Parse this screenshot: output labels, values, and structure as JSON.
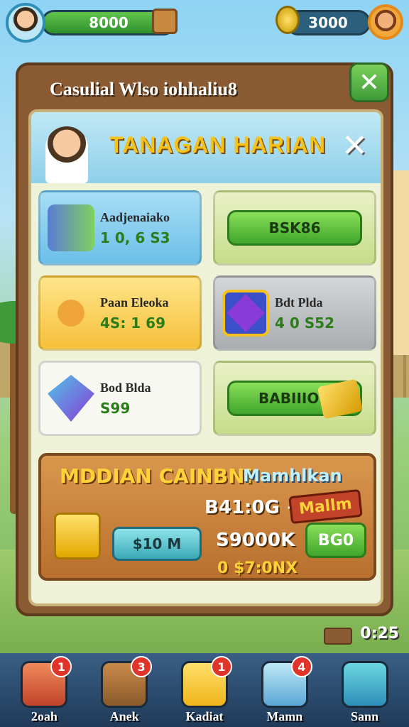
{
  "hud": {
    "coins": "8000",
    "gems": "3000"
  },
  "panel": {
    "title": "Casulial Wlso iohhaliu8",
    "close_label": "✕"
  },
  "banner": {
    "title": "TANAGAN HARIAN",
    "close_label": "✕"
  },
  "cards": [
    {
      "name": "Aadjenaiako",
      "value": "1 0, 6 S3"
    },
    {
      "button": "BSK86"
    },
    {
      "name": "Paan Eleoka",
      "value": "4S: 1 69"
    },
    {
      "name": "Bdt Plda",
      "value": "4 0   S52"
    },
    {
      "name": "Bod Blda",
      "value": "S99"
    },
    {
      "button": "BABIIIOD"
    }
  ],
  "offer": {
    "title": "MDDIAN CAINBN!",
    "subtitle": "Mamhlkan",
    "price_a": "B41:0G +",
    "tag": "Mallm",
    "pill": "$10 M",
    "price_b": "S9000K",
    "green_button": "BG0",
    "price_c": "0 $7:0NX"
  },
  "timer": "0:25",
  "nav": [
    {
      "label": "2oah",
      "badge": "1"
    },
    {
      "label": "Anek",
      "badge": "3"
    },
    {
      "label": "Kadiat",
      "badge": "1"
    },
    {
      "label": "Mamn",
      "badge": "4"
    },
    {
      "label": "Sann",
      "badge": ""
    }
  ]
}
